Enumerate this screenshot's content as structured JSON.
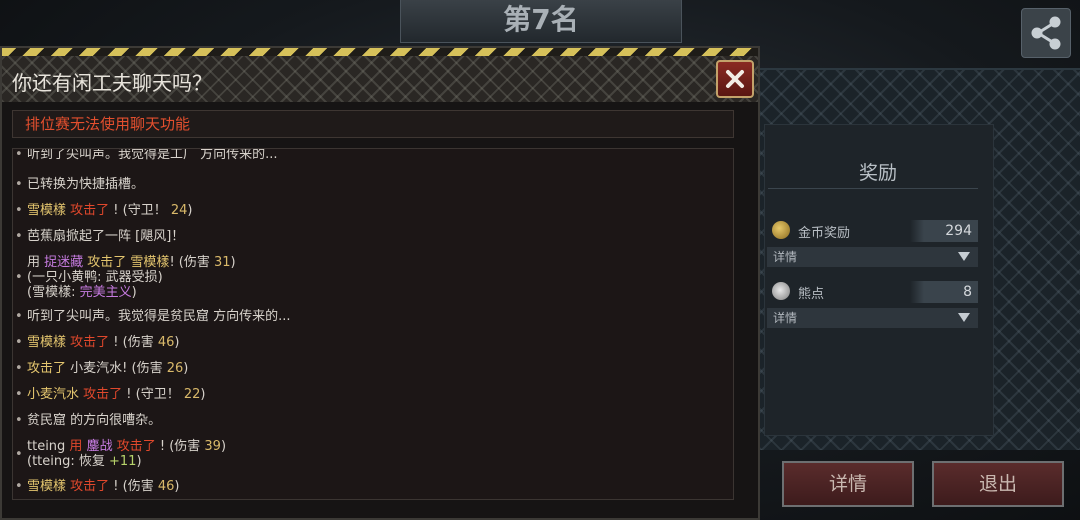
{
  "rank_banner": "第7名",
  "reward": {
    "title": "奖励",
    "rows": [
      {
        "label": "金币奖励",
        "value": "294",
        "icon": "gold-coin-icon"
      },
      {
        "label": "熊点",
        "value": "8",
        "icon": "bear-points-icon"
      }
    ],
    "select_value": "详情"
  },
  "buttons": {
    "details": "详情",
    "exit": "退出"
  },
  "chat": {
    "title": "你还有闲工夫聊天吗？",
    "notice": "排位赛无法使用聊天功能",
    "entries": [
      {
        "lines": [
          [
            [
              "听到了尖叫声。我觉得是工厂 方向传来的...",
              "w"
            ]
          ]
        ]
      },
      {
        "lines": [
          [
            [
              "已转换为快捷插槽。",
              "w"
            ]
          ]
        ]
      },
      {
        "lines": [
          [
            [
              "雪模樣",
              "y"
            ],
            [
              "  攻击了",
              "r"
            ],
            [
              " ! (守卫！",
              "w"
            ],
            [
              " 24",
              "o"
            ],
            [
              ")",
              "w"
            ]
          ]
        ]
      },
      {
        "lines": [
          [
            [
              "芭蕉扇掀起了一阵 [飓风]！",
              "w"
            ]
          ]
        ]
      },
      {
        "lines": [
          [
            [
              "用 ",
              "w"
            ],
            [
              "捉迷藏",
              "p"
            ],
            [
              " 攻击了 ",
              "y"
            ],
            [
              " 雪模樣",
              "y"
            ],
            [
              "! (伤害",
              "w"
            ],
            [
              " 31",
              "o"
            ],
            [
              ")",
              "w"
            ]
          ],
          [
            [
              "(一只小黄鸭: 武器受损)",
              "w"
            ]
          ],
          [
            [
              "(雪模樣: ",
              "w"
            ],
            [
              "完美主义",
              "p"
            ],
            [
              ")",
              "w"
            ]
          ]
        ]
      },
      {
        "lines": [
          [
            [
              "听到了尖叫声。我觉得是贫民窟 方向传来的...",
              "w"
            ]
          ]
        ]
      },
      {
        "lines": [
          [
            [
              "雪模樣",
              "y"
            ],
            [
              "  攻击了",
              "r"
            ],
            [
              " ! (伤害",
              "w"
            ],
            [
              " 46",
              "o"
            ],
            [
              ")",
              "w"
            ]
          ]
        ]
      },
      {
        "lines": [
          [
            [
              "攻击了",
              "y"
            ],
            [
              " 小麦汽水! (伤害",
              "w"
            ],
            [
              " 26",
              "o"
            ],
            [
              ")",
              "w"
            ]
          ]
        ]
      },
      {
        "lines": [
          [
            [
              "小麦汽水",
              "y"
            ],
            [
              "  攻击了",
              "r"
            ],
            [
              " ! (守卫！",
              "w"
            ],
            [
              " 22",
              "o"
            ],
            [
              ")",
              "w"
            ]
          ]
        ]
      },
      {
        "lines": [
          [
            [
              "贫民窟 的方向很嘈杂。",
              "w"
            ]
          ]
        ]
      },
      {
        "lines": [
          [
            [
              "tteing",
              "w"
            ],
            [
              "  用 ",
              "r"
            ],
            [
              "鏖战",
              "p"
            ],
            [
              " 攻击了",
              "r"
            ],
            [
              "  ! (伤害",
              "w"
            ],
            [
              " 39",
              "o"
            ],
            [
              ")",
              "w"
            ]
          ],
          [
            [
              "(tteing: 恢复",
              "w"
            ],
            [
              " +11",
              "g"
            ],
            [
              ")",
              "w"
            ]
          ]
        ]
      },
      {
        "lines": [
          [
            [
              "雪模樣",
              "y"
            ],
            [
              "  攻击了",
              "r"
            ],
            [
              " ! (伤害",
              "w"
            ],
            [
              " 46",
              "o"
            ],
            [
              ")",
              "w"
            ]
          ]
        ]
      }
    ]
  }
}
